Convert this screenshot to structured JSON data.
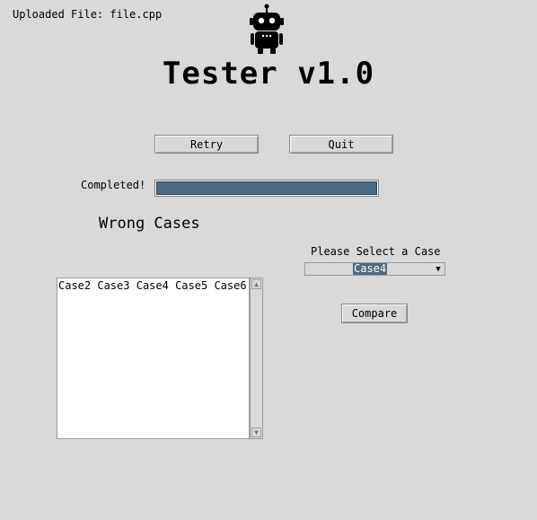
{
  "header": {
    "uploaded_label": "Uploaded File: file.cpp",
    "title": "Tester v1.0",
    "logo_icon": "robot-icon"
  },
  "buttons": {
    "retry_label": "Retry",
    "quit_label": "Quit",
    "compare_label": "Compare"
  },
  "progress": {
    "status_label": "Completed!",
    "value": 1.0
  },
  "wrong_cases": {
    "heading": "Wrong Cases",
    "items": [
      "Case2",
      "Case3",
      "Case4",
      "Case5",
      "Case6"
    ]
  },
  "case_select": {
    "label": "Please Select a Case",
    "selected": "Case4",
    "arrow_icon": "chevron-down-icon"
  },
  "colors": {
    "background": "#d9d9d9",
    "accent": "#4b6a84"
  }
}
